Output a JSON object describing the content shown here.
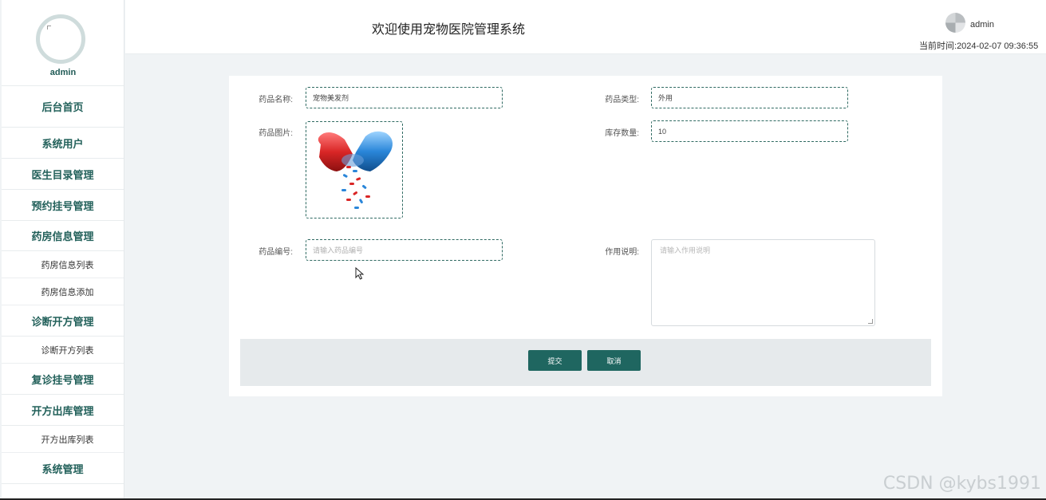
{
  "sidebar": {
    "profile_name": "admin",
    "items": [
      {
        "label": "后台首页",
        "type": "main"
      },
      {
        "label": "系统用户",
        "type": "main"
      },
      {
        "label": "医生目录管理",
        "type": "main"
      },
      {
        "label": "预约挂号管理",
        "type": "main"
      },
      {
        "label": "药房信息管理",
        "type": "main"
      },
      {
        "label": "药房信息列表",
        "type": "sub"
      },
      {
        "label": "药房信息添加",
        "type": "sub"
      },
      {
        "label": "诊断开方管理",
        "type": "main"
      },
      {
        "label": "诊断开方列表",
        "type": "sub"
      },
      {
        "label": "复诊挂号管理",
        "type": "main"
      },
      {
        "label": "开方出库管理",
        "type": "main"
      },
      {
        "label": "开方出库列表",
        "type": "sub"
      },
      {
        "label": "系统管理",
        "type": "main"
      }
    ]
  },
  "header": {
    "title": "欢迎使用宠物医院管理系统",
    "user_name": "admin",
    "time_label": "当前时间:",
    "time_value": "2024-02-07 09:36:55"
  },
  "form": {
    "name_label": "药品名称:",
    "name_value": "宠物美发剂",
    "type_label": "药品类型:",
    "type_value": "外用",
    "image_label": "药品图片:",
    "stock_label": "库存数量:",
    "stock_value": "10",
    "code_label": "药品编号:",
    "code_placeholder": "请输入药品编号",
    "desc_label": "作用说明:",
    "desc_placeholder": "请输入作用说明",
    "submit_label": "提交",
    "cancel_label": "取消"
  },
  "watermark": "CSDN @kybs1991",
  "colors": {
    "accent": "#1f6660",
    "nav_text": "#23615b",
    "page_bg": "#f0f3f5"
  }
}
